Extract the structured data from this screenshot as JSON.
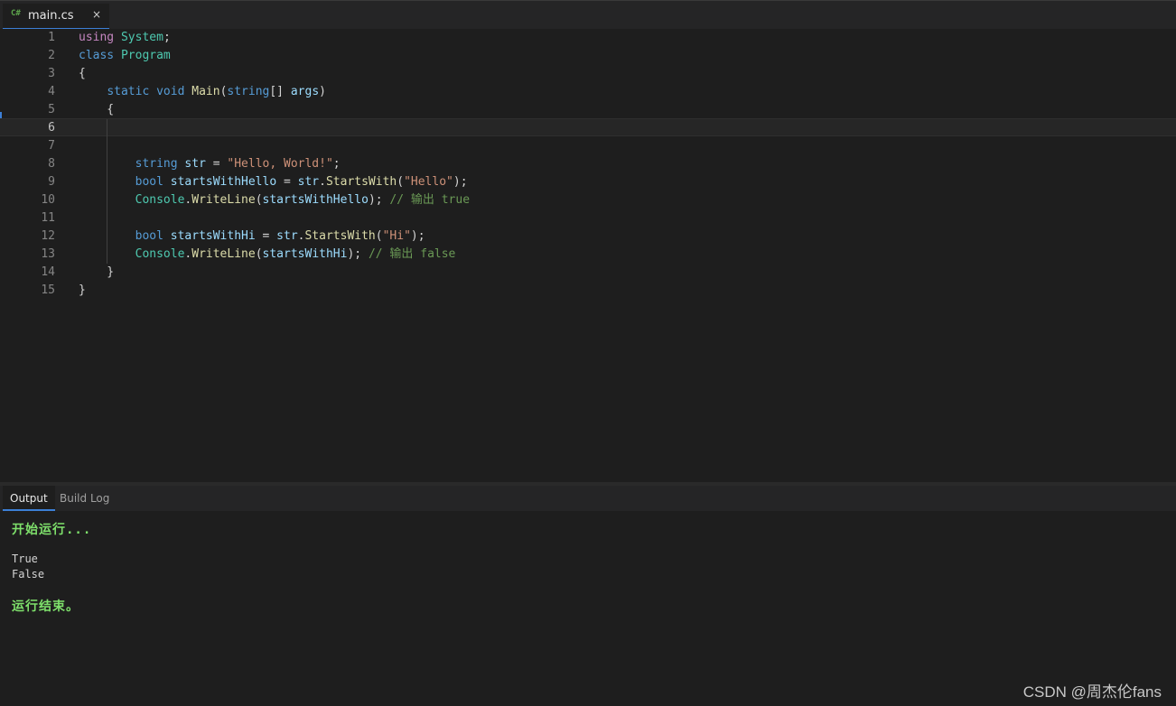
{
  "tab": {
    "icon_text": "C#",
    "filename": "main.cs",
    "close_glyph": "×"
  },
  "editor": {
    "lines": [
      {
        "n": "1",
        "code": "using System;"
      },
      {
        "n": "2",
        "code": "class Program"
      },
      {
        "n": "3",
        "code": "{"
      },
      {
        "n": "4",
        "code": "    static void Main(string[] args)"
      },
      {
        "n": "5",
        "code": "    {"
      },
      {
        "n": "6",
        "code": ""
      },
      {
        "n": "7",
        "code": ""
      },
      {
        "n": "8",
        "code": "        string str = \"Hello, World!\";"
      },
      {
        "n": "9",
        "code": "        bool startsWithHello = str.StartsWith(\"Hello\");"
      },
      {
        "n": "10",
        "code": "        Console.WriteLine(startsWithHello); // 输出 true"
      },
      {
        "n": "11",
        "code": ""
      },
      {
        "n": "12",
        "code": "        bool startsWithHi = str.StartsWith(\"Hi\");"
      },
      {
        "n": "13",
        "code": "        Console.WriteLine(startsWithHi); // 输出 false"
      },
      {
        "n": "14",
        "code": "    }"
      },
      {
        "n": "15",
        "code": "}"
      }
    ],
    "current_line": "6"
  },
  "panel": {
    "tabs": [
      "Output",
      "Build Log"
    ],
    "active_tab": "Output"
  },
  "output": {
    "start": "开始运行...",
    "results": [
      "True",
      "False"
    ],
    "end": "运行结束。"
  },
  "watermark": "CSDN @周杰伦fans",
  "colors": {
    "accent": "#3c7fd6",
    "output_green": "#7ee06b",
    "keyword": "#569cd6",
    "type": "#4ec9b0",
    "string": "#ce9178",
    "comment": "#6a9955"
  }
}
